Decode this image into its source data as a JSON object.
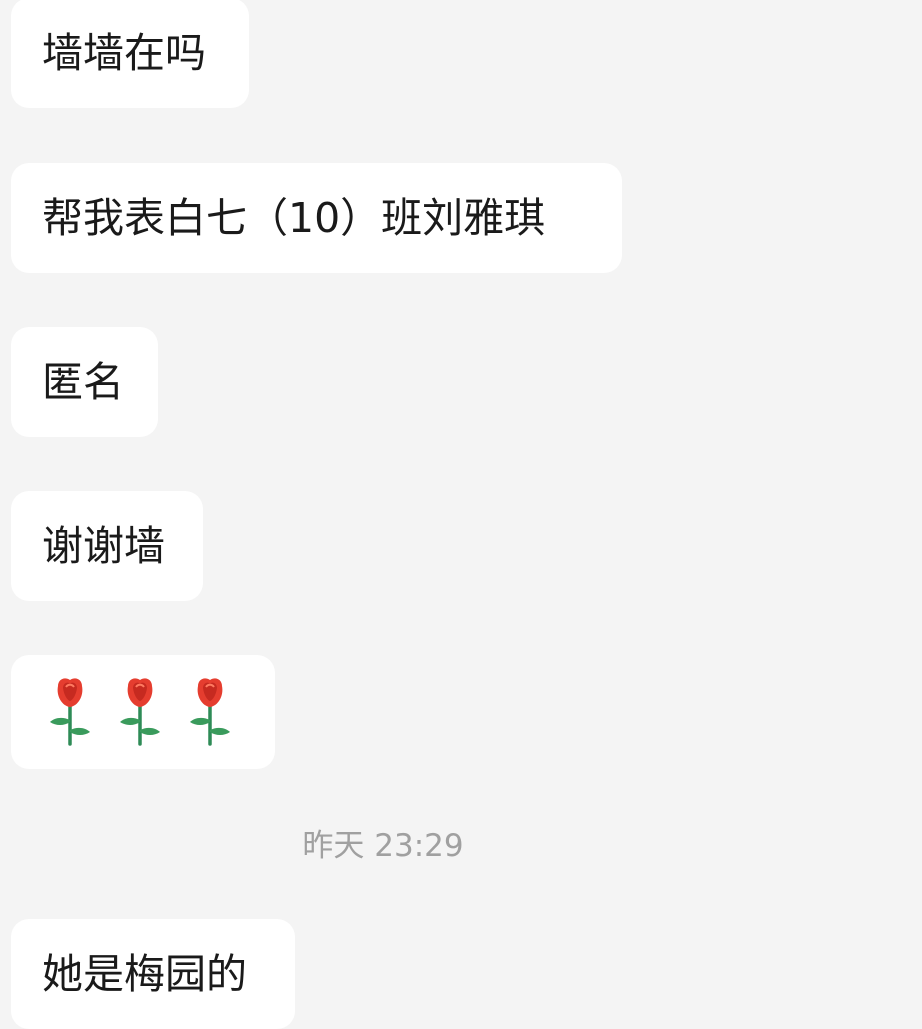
{
  "chat": {
    "messages": [
      {
        "text": "墙墙在吗"
      },
      {
        "text": "帮我表白七（10）班刘雅琪"
      },
      {
        "text": "匿名"
      },
      {
        "text": "谢谢墙"
      },
      {
        "emoji": "rose-icon",
        "count": 3
      },
      {
        "text": "她是梅园的"
      }
    ],
    "timestamp": "昨天 23:29"
  },
  "colors": {
    "background": "#f4f4f4",
    "bubble": "#ffffff",
    "text": "#1a1a1a",
    "timestamp": "#a0a0a0"
  }
}
